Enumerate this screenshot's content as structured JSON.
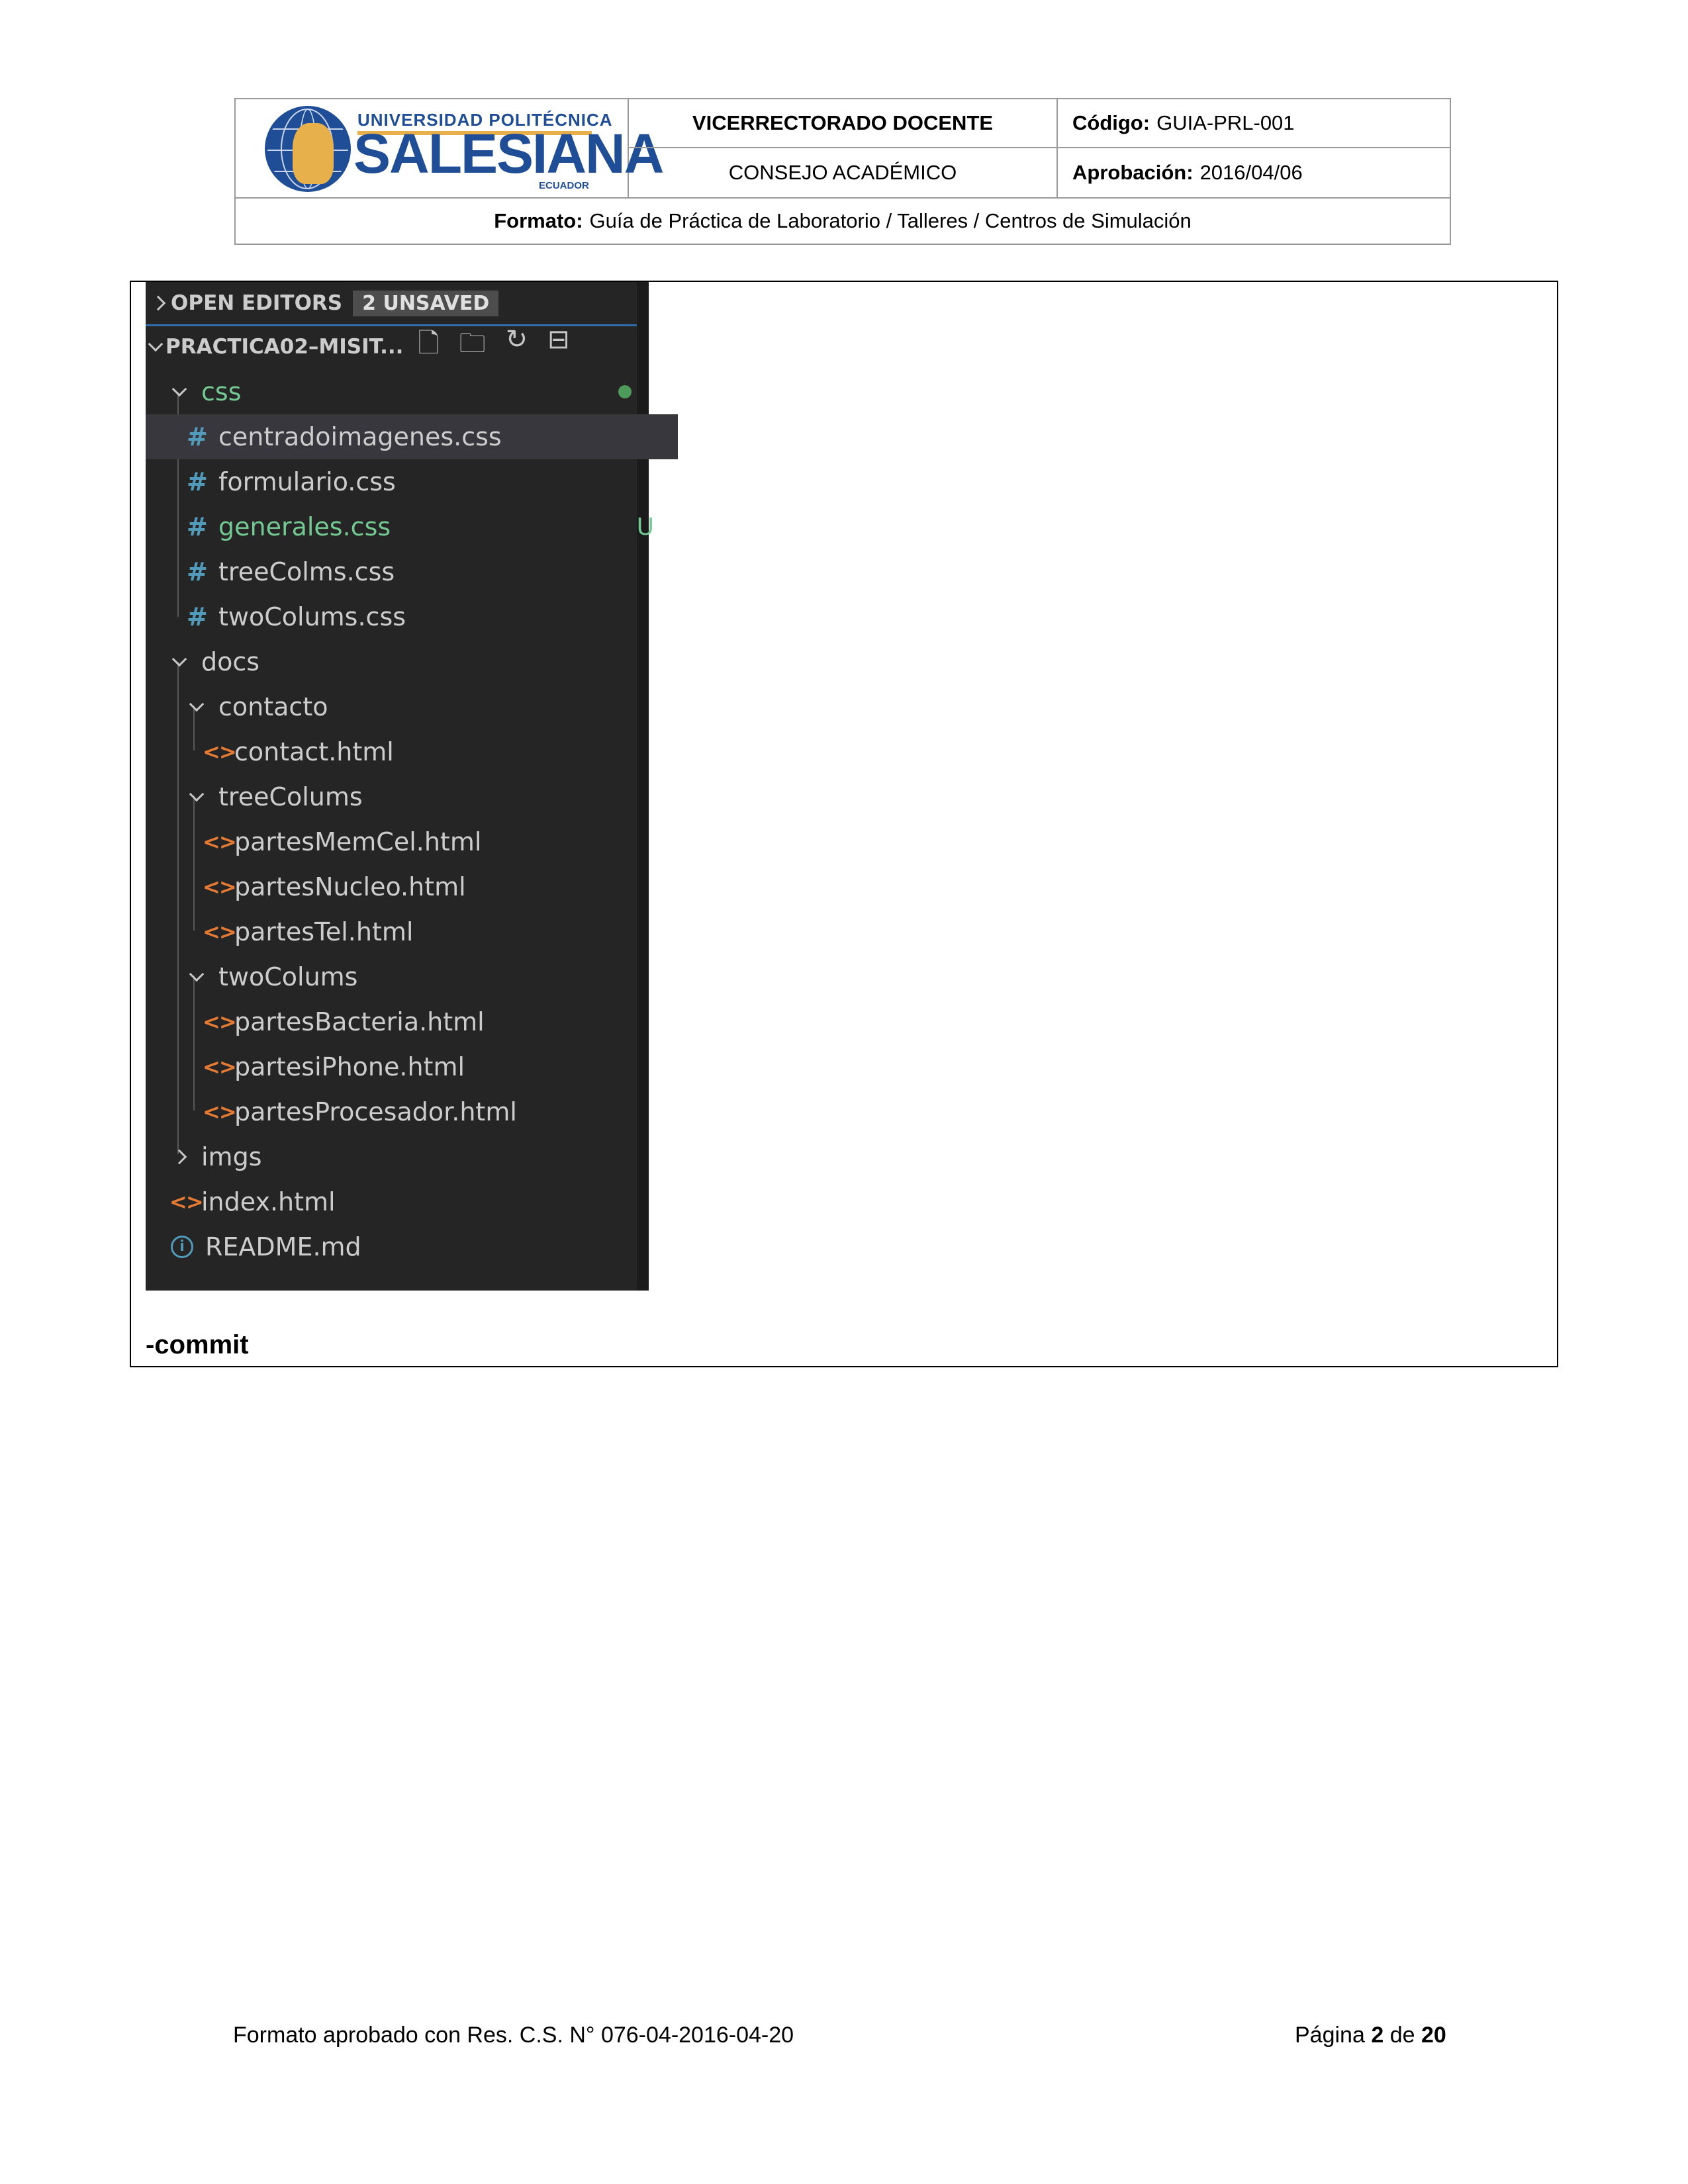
{
  "header": {
    "logo": {
      "university": "UNIVERSIDAD POLITÉCNICA",
      "name": "SALESIANA",
      "country": "ECUADOR"
    },
    "office": "VICERRECTORADO DOCENTE",
    "council": "CONSEJO ACADÉMICO",
    "code_label": "Código:",
    "code_value": "GUIA-PRL-001",
    "approval_label": "Aprobación:",
    "approval_value": "2016/04/06",
    "format_label": "Formato:",
    "format_value": "Guía de Práctica de Laboratorio / Talleres / Centros de Simulación"
  },
  "explorer": {
    "open_editors": "OPEN EDITORS",
    "unsaved_badge": "2 UNSAVED",
    "project": "PRACTICA02–MISIT...",
    "action_icons": [
      "new-file-icon",
      "new-folder-icon",
      "refresh-icon",
      "collapse-all-icon"
    ],
    "items": [
      {
        "label": "css",
        "kind": "folder"
      },
      {
        "label": "centradoimagenes.css",
        "kind": "css"
      },
      {
        "label": "formulario.css",
        "kind": "css"
      },
      {
        "label": "generales.css",
        "kind": "css",
        "status": "U"
      },
      {
        "label": "treeColms.css",
        "kind": "css"
      },
      {
        "label": "twoColums.css",
        "kind": "css"
      },
      {
        "label": "docs",
        "kind": "folder"
      },
      {
        "label": "contacto",
        "kind": "folder"
      },
      {
        "label": "contact.html",
        "kind": "html"
      },
      {
        "label": "treeColums",
        "kind": "folder"
      },
      {
        "label": "partesMemCel.html",
        "kind": "html"
      },
      {
        "label": "partesNucleo.html",
        "kind": "html"
      },
      {
        "label": "partesTel.html",
        "kind": "html"
      },
      {
        "label": "twoColums",
        "kind": "folder"
      },
      {
        "label": "partesBacteria.html",
        "kind": "html"
      },
      {
        "label": "partesiPhone.html",
        "kind": "html"
      },
      {
        "label": "partesProcesador.html",
        "kind": "html"
      },
      {
        "label": "imgs",
        "kind": "folder"
      },
      {
        "label": "index.html",
        "kind": "html"
      },
      {
        "label": "README.md",
        "kind": "info"
      }
    ],
    "colors": {
      "css_icon": "#519aba",
      "html_icon": "#e37933",
      "untracked": "#73c991",
      "selection": "#37373d"
    }
  },
  "body_text": "-commit",
  "footer": {
    "left": "Formato aprobado con Res. C.S. N° 076-04-2016-04-20",
    "page_prefix": "Página",
    "page_current": "2",
    "page_sep": "de",
    "page_total": "20"
  }
}
